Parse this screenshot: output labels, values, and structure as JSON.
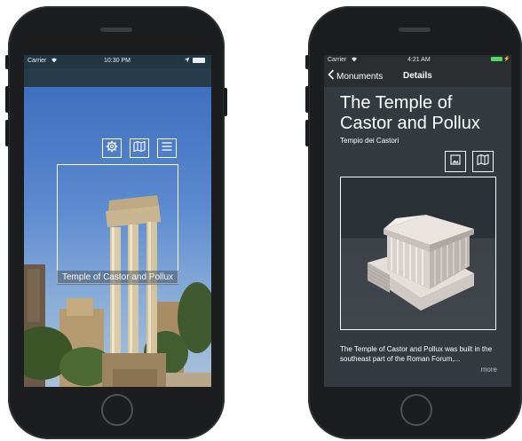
{
  "left_phone": {
    "status": {
      "carrier": "Carrier",
      "time": "10:30 PM"
    },
    "toolbar": {
      "icons": [
        "gear-icon",
        "map-icon",
        "menu-icon"
      ]
    },
    "recognized_label": "Temple of Castor and Pollux"
  },
  "right_phone": {
    "status": {
      "carrier": "Carrier",
      "time": "4:21 AM"
    },
    "nav": {
      "back_label": "Monuments",
      "title": "Details"
    },
    "title": "The Temple of Castor and Pollux",
    "subtitle": "Tempio dei Castori",
    "toolbar": {
      "icons": [
        "image-icon",
        "map-icon"
      ]
    },
    "description": "The Temple of Castor and Pollux was built in the southeast part of the Roman Forum,...",
    "more_label": "more"
  },
  "colors": {
    "phone_body": "#1c1d1f",
    "left_statusbar": "#233644",
    "right_screen_bg": "#343a3f",
    "battery_green": "#4cd964"
  }
}
